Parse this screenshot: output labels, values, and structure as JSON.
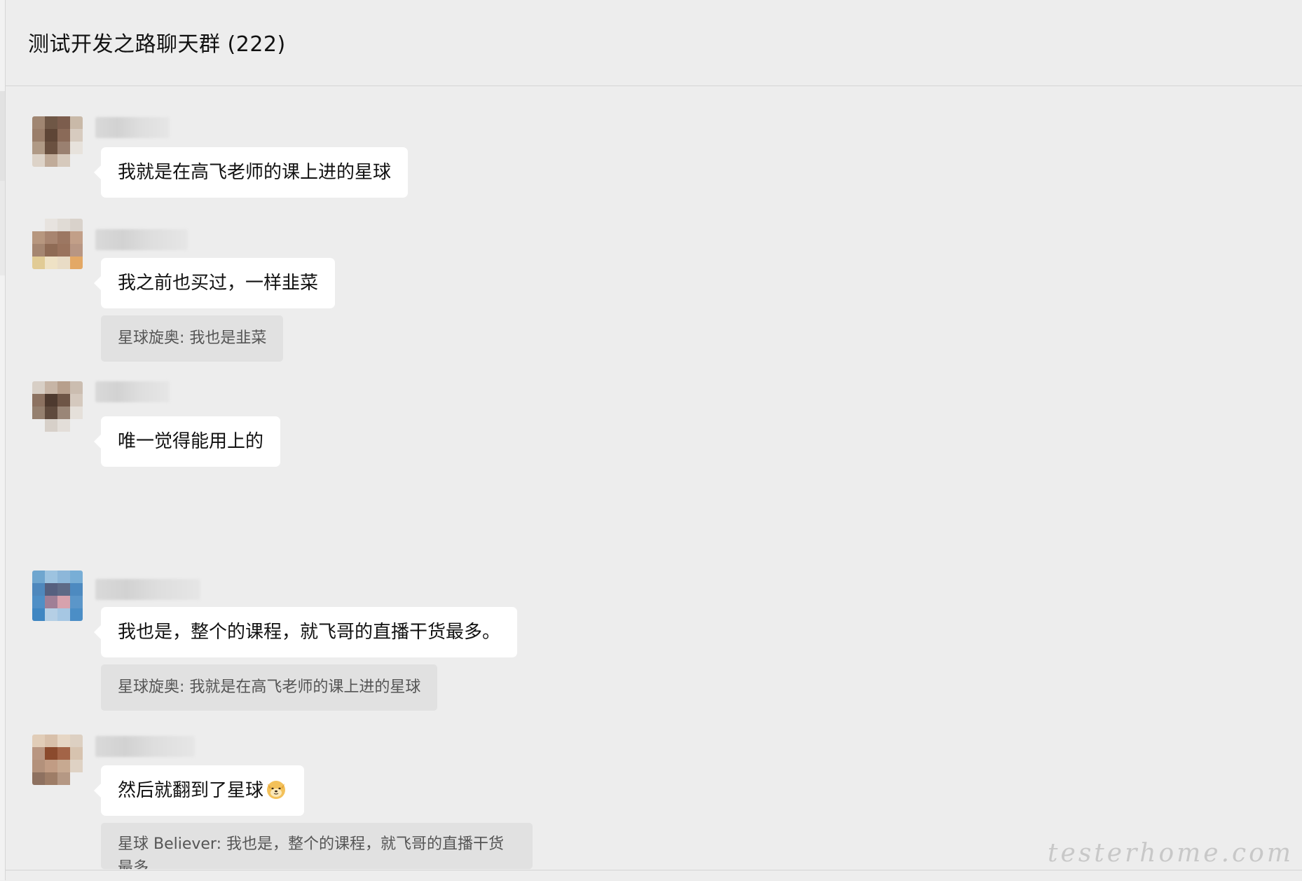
{
  "window": {
    "title": "测试开发之路聊天群 (222)"
  },
  "messages": [
    {
      "text": "我就是在高飞老师的课上进的星球"
    },
    {
      "text": "我之前也买过，一样韭菜",
      "quote": "星球旋奥: 我也是韭菜"
    },
    {
      "text": "唯一觉得能用上的"
    },
    {
      "text": "我也是，整个的课程，就飞哥的直播干货最多。",
      "quote": "星球旋奥: 我就是在高飞老师的课上进的星球"
    },
    {
      "text": "然后就翻到了星球",
      "emoji": "doge-emoji",
      "quote": "星球 Believer: 我也是，整个的课程，就飞哥的直播干货最多"
    }
  ],
  "watermark": "testerhome.com",
  "colors": {
    "background": "#ededed",
    "bubble": "#ffffff",
    "quote": "#e1e1e1",
    "divider": "#d4d4d4"
  }
}
